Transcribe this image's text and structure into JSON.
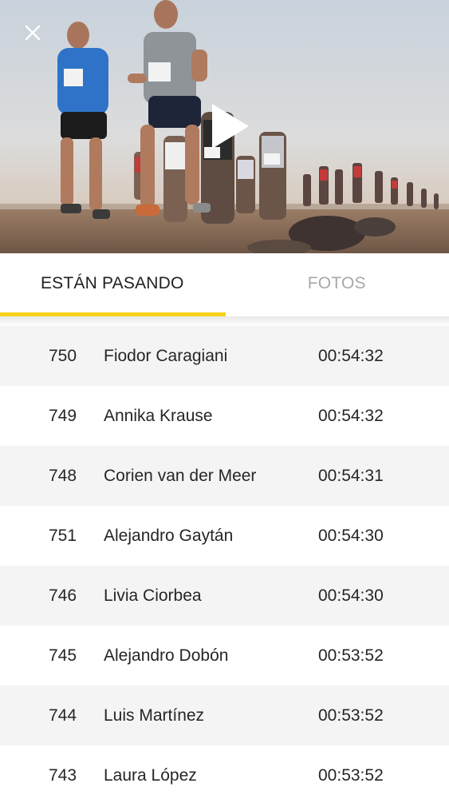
{
  "hero": {
    "close_icon": "close-icon",
    "play_icon": "play-icon"
  },
  "tabs": [
    {
      "label": "ESTÁN PASANDO",
      "active": true
    },
    {
      "label": "FOTOS",
      "active": false
    }
  ],
  "colors": {
    "accent": "#f7d21a",
    "row_alt": "#f4f4f4",
    "tab_inactive": "#a8a8a8"
  },
  "runners": [
    {
      "bib": "750",
      "name": "Fiodor Caragiani",
      "time": "00:54:32"
    },
    {
      "bib": "749",
      "name": "Annika Krause",
      "time": "00:54:32"
    },
    {
      "bib": "748",
      "name": "Corien van der Meer",
      "time": "00:54:31"
    },
    {
      "bib": "751",
      "name": "Alejandro Gaytán",
      "time": "00:54:30"
    },
    {
      "bib": "746",
      "name": "Livia Ciorbea",
      "time": "00:54:30"
    },
    {
      "bib": "745",
      "name": "Alejandro Dobón",
      "time": "00:53:52"
    },
    {
      "bib": "744",
      "name": "Luis Martínez",
      "time": "00:53:52"
    },
    {
      "bib": "743",
      "name": "Laura López",
      "time": "00:53:52"
    }
  ]
}
